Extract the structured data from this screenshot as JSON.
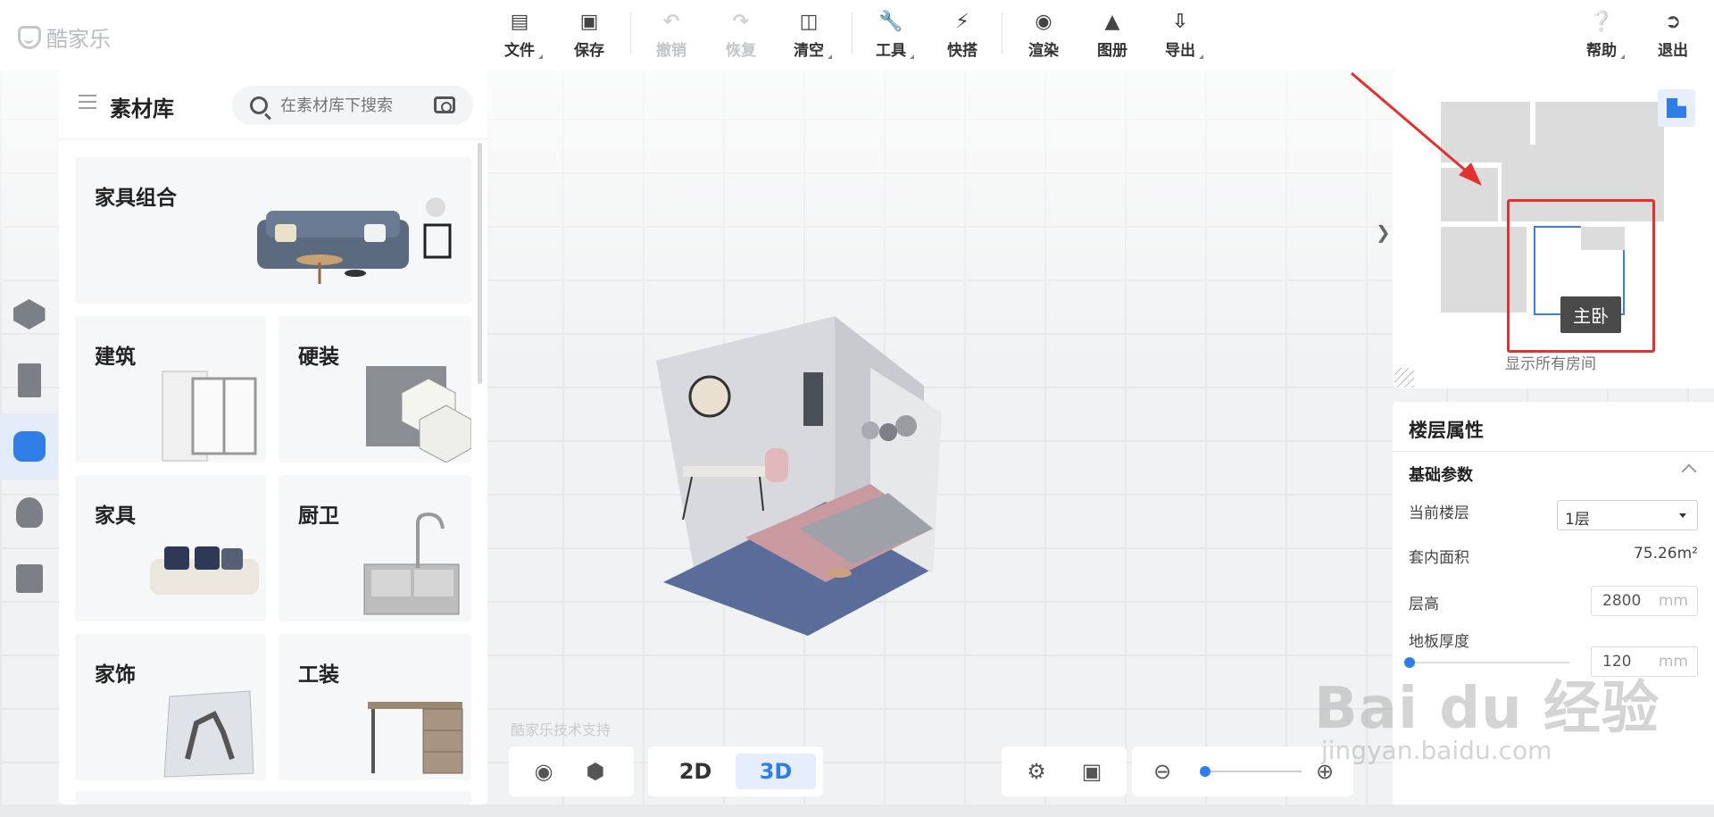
{
  "app": {
    "logo_text": "酷家乐"
  },
  "toolbar": {
    "items": [
      {
        "label": "文件",
        "icon": "file-icon",
        "has_menu": true
      },
      {
        "label": "保存",
        "icon": "save-icon",
        "has_menu": false
      },
      {
        "label": "撤销",
        "icon": "undo-icon",
        "disabled": true
      },
      {
        "label": "恢复",
        "icon": "redo-icon",
        "disabled": true
      },
      {
        "label": "清空",
        "icon": "eraser-icon",
        "has_menu": true
      },
      {
        "label": "工具",
        "icon": "wrench-icon",
        "has_menu": true
      },
      {
        "label": "快搭",
        "icon": "lightning-icon",
        "has_menu": false
      },
      {
        "label": "渲染",
        "icon": "camera-icon",
        "has_menu": false
      },
      {
        "label": "图册",
        "icon": "image-icon",
        "has_menu": false
      },
      {
        "label": "导出",
        "icon": "export-icon",
        "has_menu": true
      }
    ],
    "help_label": "帮助",
    "exit_label": "退出"
  },
  "left_rail": [
    "cube-icon",
    "door-icon",
    "sofa-icon",
    "person-icon",
    "cabinet-icon"
  ],
  "library": {
    "title": "素材库",
    "search_placeholder": "在素材库下搜索",
    "categories": [
      {
        "label": "家具组合"
      },
      {
        "label": "建筑"
      },
      {
        "label": "硬装"
      },
      {
        "label": "家具"
      },
      {
        "label": "厨卫"
      },
      {
        "label": "家饰"
      },
      {
        "label": "工装"
      }
    ]
  },
  "minimap": {
    "room_tooltip": "主卧",
    "show_all_label": "显示所有房间"
  },
  "floor_props": {
    "title": "楼层属性",
    "section": "基础参数",
    "current_floor_label": "当前楼层",
    "current_floor_value": "1层",
    "area_label": "套内面积",
    "area_value": "75.26m²",
    "height_label": "层高",
    "height_value": "2800",
    "height_unit": "mm",
    "thickness_label": "地板厚度",
    "thickness_value": "120",
    "thickness_unit": "mm"
  },
  "view_modes": {
    "mode_2d": "2D",
    "mode_3d": "3D",
    "active": "3D"
  },
  "credit": "酷家乐技术支持",
  "watermark": {
    "main": "Bai du 经验",
    "sub": "jingyan.baidu.com"
  },
  "colors": {
    "accent": "#2f7de6",
    "highlight": "#e53030"
  }
}
